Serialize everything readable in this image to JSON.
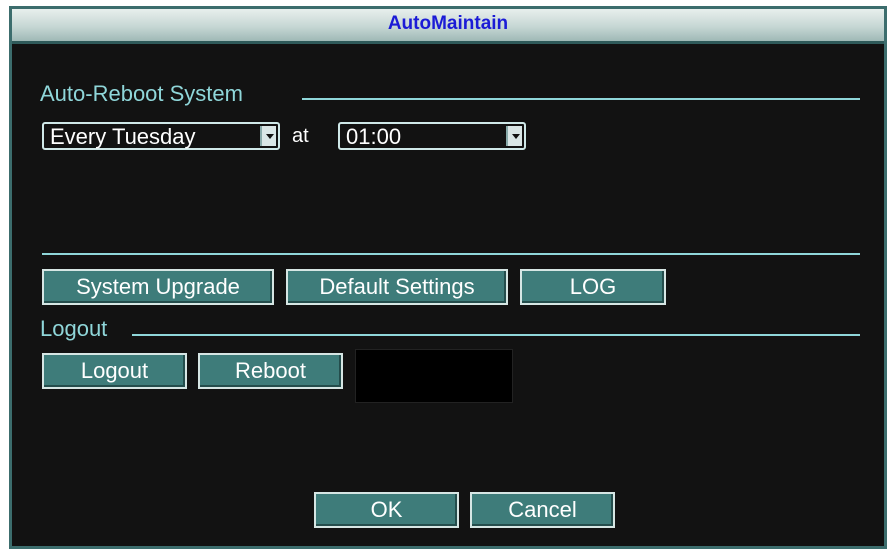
{
  "window": {
    "title": "AutoMaintain"
  },
  "auto_reboot": {
    "section_label": "Auto-Reboot System",
    "day_select": "Every Tuesday",
    "at_label": "at",
    "time_select": "01:00"
  },
  "actions": {
    "system_upgrade": "System Upgrade",
    "default_settings": "Default Settings",
    "log": "LOG"
  },
  "logout_section": {
    "section_label": "Logout",
    "logout_button": "Logout",
    "reboot_button": "Reboot"
  },
  "footer": {
    "ok_button": "OK",
    "cancel_button": "Cancel"
  },
  "colors": {
    "title_text": "#1b1bd6",
    "label_text": "#8fd6d9",
    "button_face": "#3e7c7a",
    "background": "#121212"
  }
}
